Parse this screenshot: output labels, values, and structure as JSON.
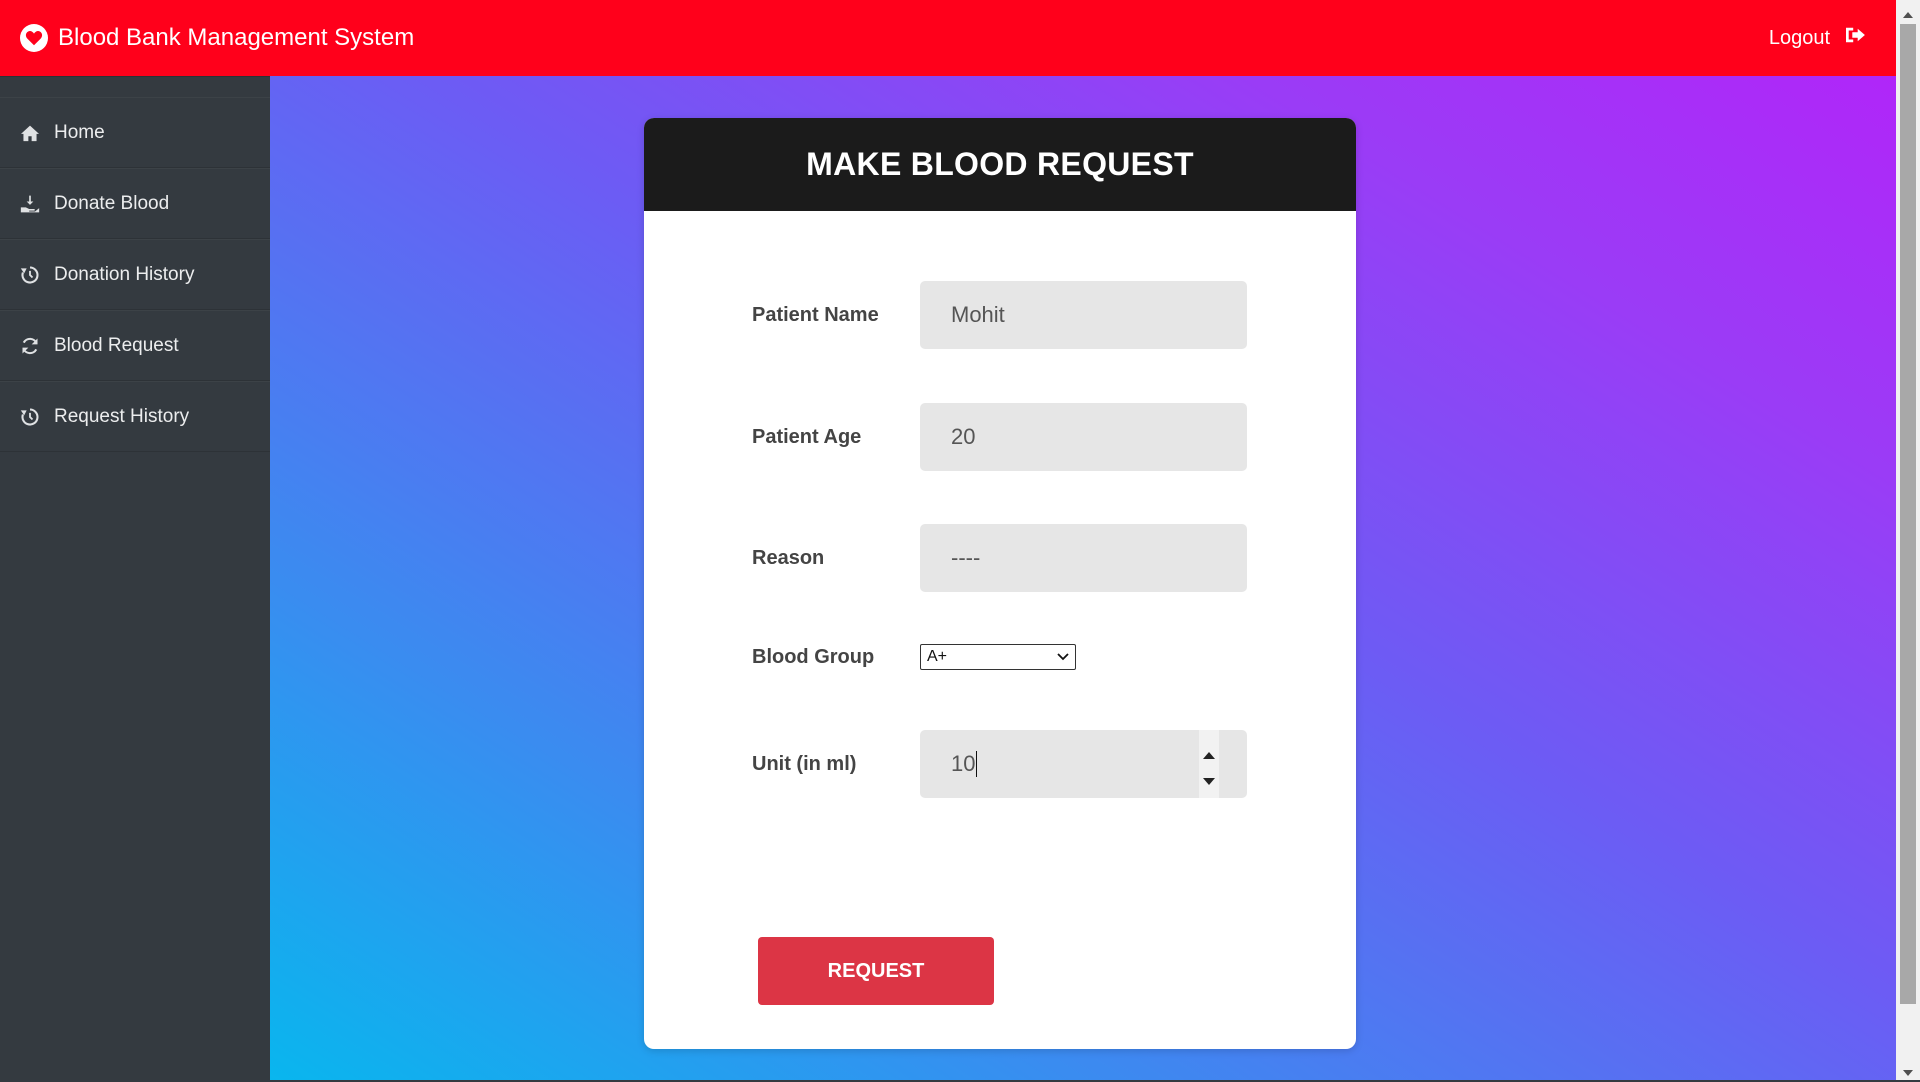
{
  "app": {
    "title": "Blood Bank Management System",
    "brand_icon": "heart-icon",
    "logout_label": "Logout",
    "logout_icon": "sign-out-icon"
  },
  "sidebar": {
    "items": [
      {
        "label": "Home",
        "icon": "home-icon"
      },
      {
        "label": "Donate Blood",
        "icon": "hand-holding-icon"
      },
      {
        "label": "Donation History",
        "icon": "history-icon"
      },
      {
        "label": "Blood Request",
        "icon": "refresh-icon"
      },
      {
        "label": "Request History",
        "icon": "history-icon"
      }
    ]
  },
  "form": {
    "heading": "MAKE BLOOD REQUEST",
    "patient_name": {
      "label": "Patient Name",
      "value": "Mohit"
    },
    "patient_age": {
      "label": "Patient Age",
      "value": "20"
    },
    "reason": {
      "label": "Reason",
      "value": "----"
    },
    "blood_group": {
      "label": "Blood Group",
      "value": "A+"
    },
    "unit": {
      "label": "Unit (in ml)",
      "value": "10"
    },
    "submit_label": "REQUEST"
  },
  "colors": {
    "topbar": "#ff001b",
    "sidebar": "#343a40",
    "card_header": "#1b1b1b",
    "button": "#dc3545",
    "gradient_start": "#09b6ee",
    "gradient_end": "#b026f9"
  }
}
